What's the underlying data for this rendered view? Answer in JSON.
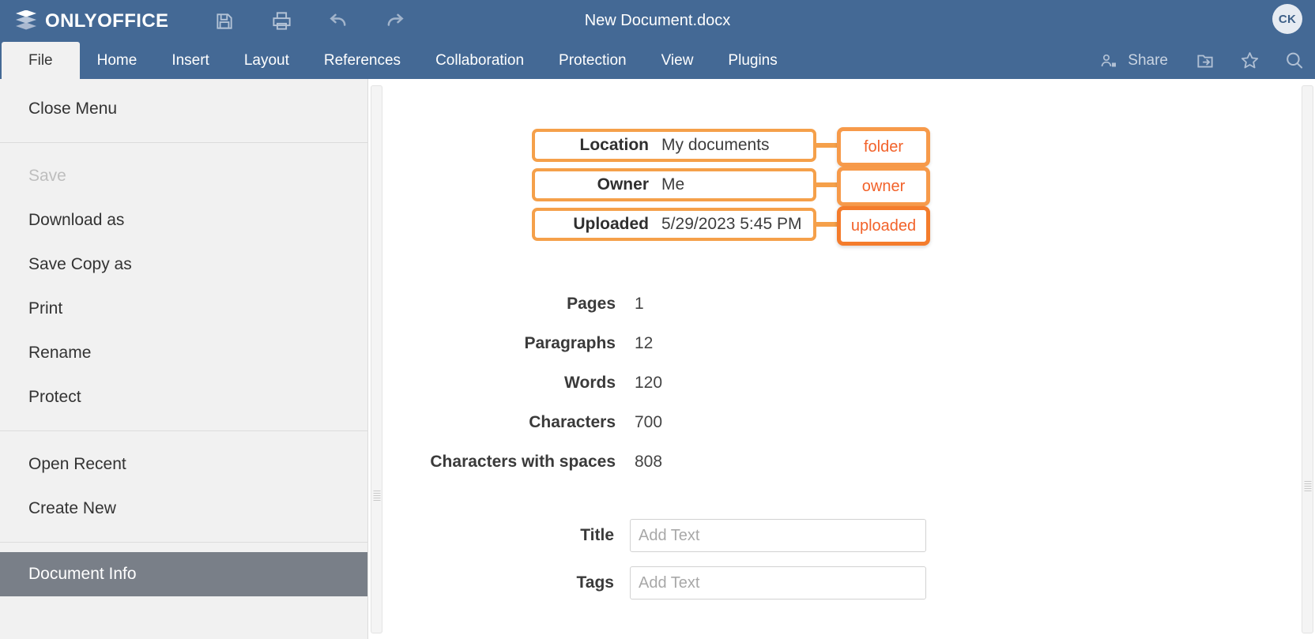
{
  "titlebar": {
    "brand": "ONLYOFFICE",
    "document_title": "New Document.docx",
    "avatar_initials": "CK",
    "icons": [
      "save-icon",
      "print-icon",
      "undo-icon",
      "redo-icon"
    ]
  },
  "tabs": [
    {
      "label": "File",
      "active": true
    },
    {
      "label": "Home",
      "active": false
    },
    {
      "label": "Insert",
      "active": false
    },
    {
      "label": "Layout",
      "active": false
    },
    {
      "label": "References",
      "active": false
    },
    {
      "label": "Collaboration",
      "active": false
    },
    {
      "label": "Protection",
      "active": false
    },
    {
      "label": "View",
      "active": false
    },
    {
      "label": "Plugins",
      "active": false
    }
  ],
  "tabbar_right": {
    "share_label": "Share",
    "icons": [
      "share-people-icon",
      "open-location-icon",
      "favorite-star-icon",
      "search-icon"
    ]
  },
  "left_menu": {
    "close_menu": "Close Menu",
    "groups": [
      [
        {
          "label": "Save",
          "state": "disabled"
        },
        {
          "label": "Download as",
          "state": "normal"
        },
        {
          "label": "Save Copy as",
          "state": "normal"
        },
        {
          "label": "Print",
          "state": "normal"
        },
        {
          "label": "Rename",
          "state": "normal"
        },
        {
          "label": "Protect",
          "state": "normal"
        }
      ],
      [
        {
          "label": "Open Recent",
          "state": "normal"
        },
        {
          "label": "Create New",
          "state": "normal"
        }
      ],
      [
        {
          "label": "Document Info",
          "state": "selected"
        }
      ]
    ]
  },
  "document_info": {
    "highlighted": [
      {
        "key": "Location",
        "value": "My documents",
        "annotation": "folder",
        "emphasis": "soft"
      },
      {
        "key": "Owner",
        "value": "Me",
        "annotation": "owner",
        "emphasis": "soft"
      },
      {
        "key": "Uploaded",
        "value": "5/29/2023 5:45 PM",
        "annotation": "uploaded",
        "emphasis": "strong"
      }
    ],
    "stats": [
      {
        "key": "Pages",
        "value": "1"
      },
      {
        "key": "Paragraphs",
        "value": "12"
      },
      {
        "key": "Words",
        "value": "120"
      },
      {
        "key": "Characters",
        "value": "700"
      },
      {
        "key": "Characters with spaces",
        "value": "808"
      }
    ],
    "fields": [
      {
        "key": "Title",
        "value": "",
        "placeholder": "Add Text"
      },
      {
        "key": "Tags",
        "value": "",
        "placeholder": "Add Text"
      }
    ]
  },
  "colors": {
    "header_blue": "#446995",
    "menu_bg": "#f1f1f1",
    "selected_item": "#797f88",
    "annotation_soft": "#f5a04a",
    "annotation_strong": "#f47c2c",
    "annotation_text": "#f2622a"
  }
}
